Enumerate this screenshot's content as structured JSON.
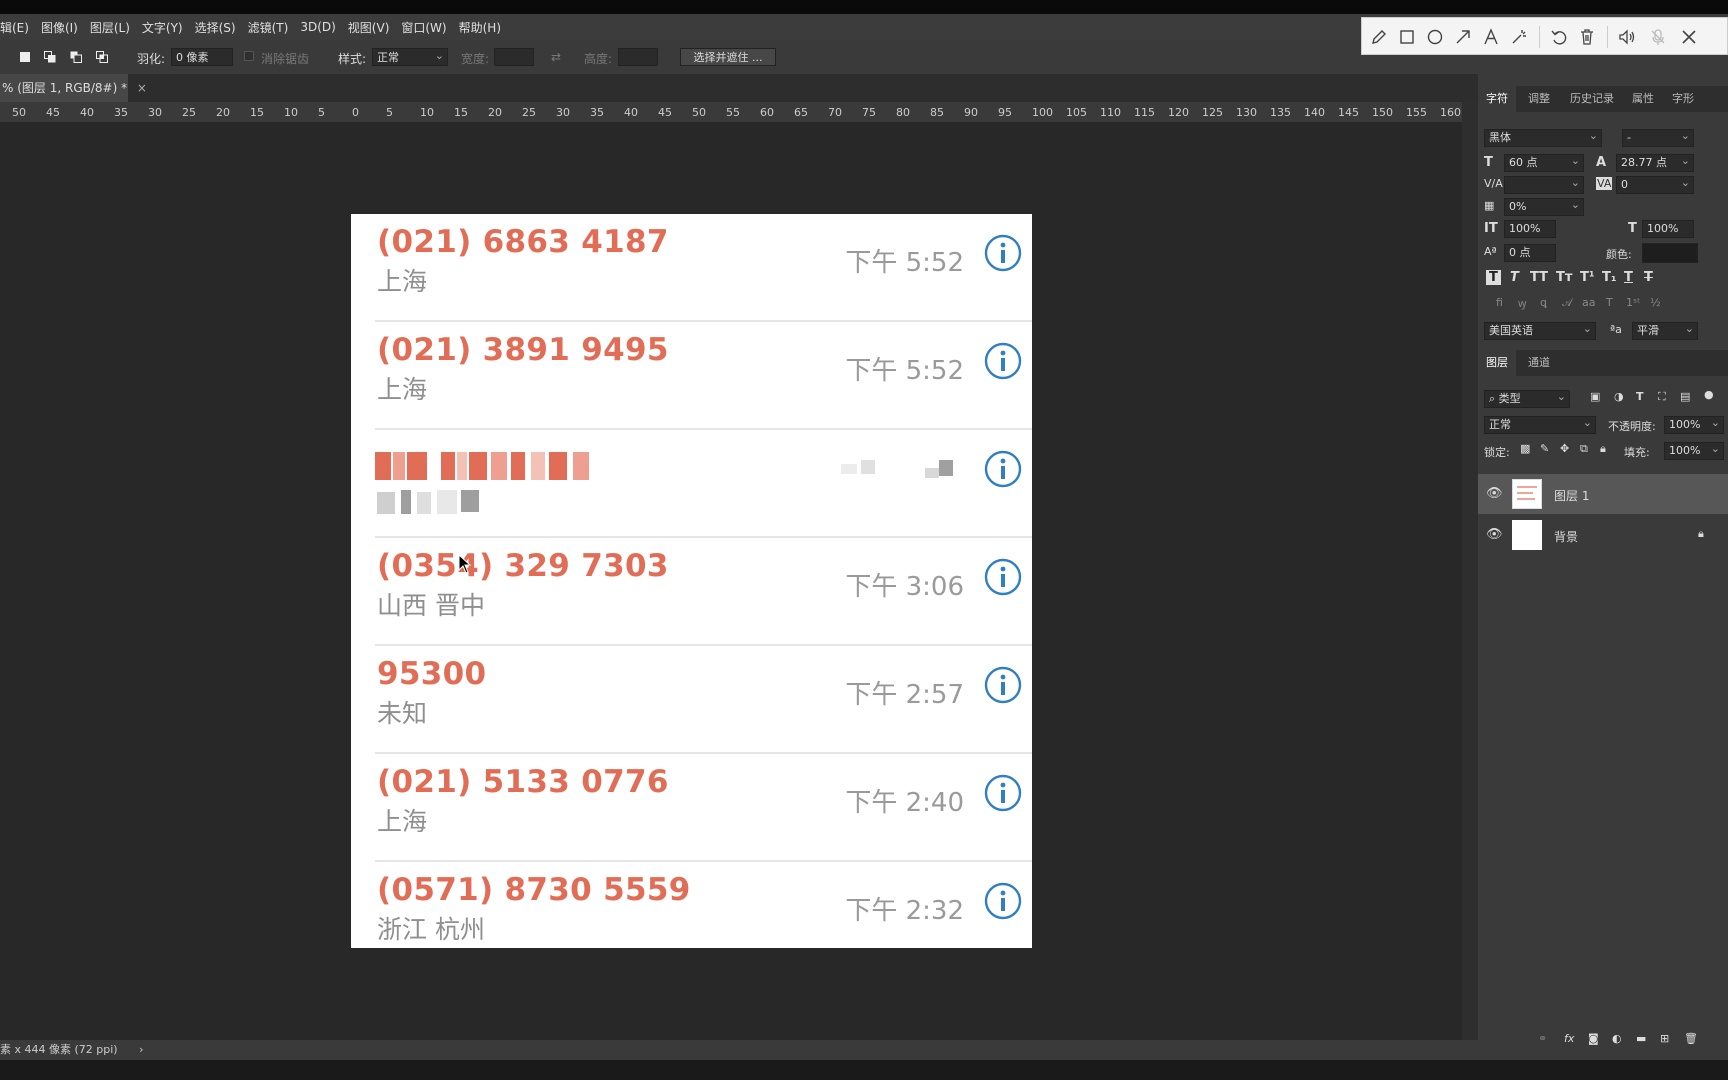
{
  "menu": [
    "辑(E)",
    "图像(I)",
    "图层(L)",
    "文字(Y)",
    "选择(S)",
    "滤镜(T)",
    "3D(D)",
    "视图(V)",
    "窗口(W)",
    "帮助(H)"
  ],
  "options": {
    "feather_label": "羽化:",
    "feather_value": "0 像素",
    "antialias_label": "消除锯齿",
    "style_label": "样式:",
    "style_value": "正常",
    "width_label": "宽度:",
    "height_label": "高度:",
    "select_mask_button": "选择并遮住 ..."
  },
  "doc_tab": "% (图层 1, RGB/8#) *",
  "doc_tab_close": "×",
  "ruler_ticks": [
    "50",
    "45",
    "40",
    "35",
    "30",
    "25",
    "20",
    "15",
    "10",
    "5",
    "0",
    "5",
    "10",
    "15",
    "20",
    "25",
    "30",
    "35",
    "40",
    "45",
    "50",
    "55",
    "60",
    "65",
    "70",
    "75",
    "80",
    "85",
    "90",
    "95",
    "100",
    "105",
    "110",
    "115",
    "120",
    "125",
    "130",
    "135",
    "140",
    "145",
    "150",
    "155",
    "160"
  ],
  "calls": [
    {
      "number": "(021) 6863 4187",
      "location": "上海",
      "time": "下午 5:52",
      "blurred": false
    },
    {
      "number": "(021) 3891 9495",
      "location": "上海",
      "time": "下午 5:52",
      "blurred": false
    },
    {
      "number": "",
      "location": "",
      "time": "",
      "blurred": true
    },
    {
      "number": "(0354) 329 7303",
      "location": "山西 晋中",
      "time": "下午 3:06",
      "blurred": false
    },
    {
      "number": "95300",
      "location": "未知",
      "time": "下午 2:57",
      "blurred": false
    },
    {
      "number": "(021) 5133 0776",
      "location": "上海",
      "time": "下午 2:40",
      "blurred": false
    },
    {
      "number": "(0571) 8730 5559",
      "location": "浙江 杭州",
      "time": "下午 2:32",
      "blurred": false
    }
  ],
  "colors": {
    "number": "#e26d56",
    "info_icon": "#2f7fc4",
    "canvas_bg": "#282828"
  },
  "status": {
    "text": "素 x 444 像素 (72 ppi)",
    "arrow": "›"
  },
  "char_panel": {
    "tabs": [
      "字符",
      "调整",
      "历史记录",
      "属性",
      "字形"
    ],
    "font_family": "黑体",
    "font_style": "-",
    "font_size": "60 点",
    "leading": "28.77 点",
    "kerning": "",
    "tracking": "0",
    "scale_pct": "0%",
    "vert_scale": "100%",
    "horiz_scale": "100%",
    "baseline": "0 点",
    "color_label": "颜色:",
    "language": "美国英语",
    "aa_label": "ªa",
    "antialias": "平滑"
  },
  "layers_panel": {
    "tabs": [
      "图层",
      "通道"
    ],
    "filter": "类型",
    "blend_mode": "正常",
    "opacity_label": "不透明度:",
    "opacity": "100%",
    "lock_label": "锁定:",
    "fill_label": "填充:",
    "fill": "100%",
    "layers": [
      {
        "name": "图层 1",
        "selected": true
      },
      {
        "name": "背景",
        "selected": false
      }
    ]
  }
}
